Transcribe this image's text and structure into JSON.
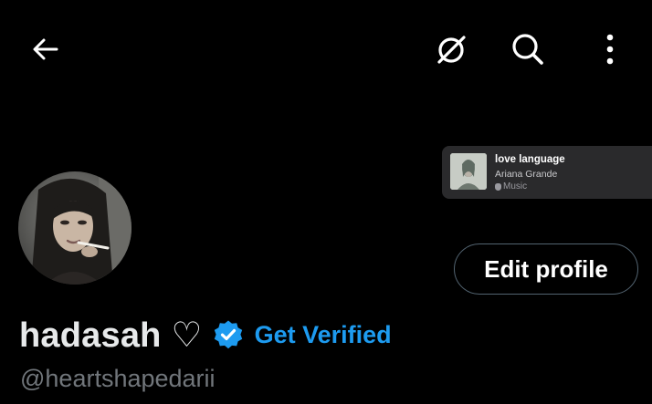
{
  "header": {
    "back_icon": "arrow-left-icon",
    "pin_icon": "grok-slash-icon",
    "search_icon": "search-icon",
    "more_icon": "more-vertical-icon"
  },
  "now_playing": {
    "title": "love language",
    "artist": "Ariana Grande",
    "service": "Music",
    "service_icon": "apple-icon"
  },
  "profile": {
    "display_name": "hadasah ♡",
    "handle": "@heartshapedarii",
    "verified_badge_icon": "verified-badge-icon",
    "get_verified_label": "Get Verified",
    "edit_profile_label": "Edit profile"
  },
  "colors": {
    "background": "#000000",
    "accent": "#1d9bf0",
    "text_primary": "#e7e9ea",
    "text_secondary": "#71767b",
    "button_border": "#536471"
  }
}
